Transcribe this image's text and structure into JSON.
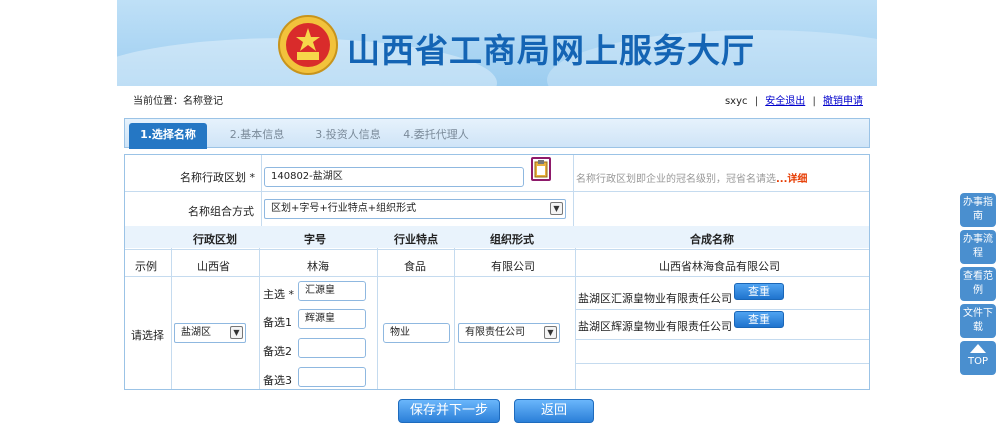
{
  "banner": {
    "title": "山西省工商局网上服务大厅"
  },
  "topbar": {
    "breadcrumb": "当前位置：名称登记",
    "username": "sxyc",
    "logout": "安全退出",
    "withdraw": "撤销申请"
  },
  "tabs": [
    {
      "label": "1.选择名称"
    },
    {
      "label": "2.基本信息"
    },
    {
      "label": "3.投资人信息"
    },
    {
      "label": "4.委托代理人"
    }
  ],
  "form": {
    "region_label": "名称行政区划 *",
    "region_value": "140802-盐湖区",
    "hint": "名称行政区划即企业的冠名级别，冠省名请选",
    "hint_link": "...详细",
    "combo_label": "名称组合方式",
    "combo_value": "区划+字号+行业特点+组织形式"
  },
  "table": {
    "headers": [
      "行政区划",
      "字号",
      "行业特点",
      "组织形式",
      "合成名称"
    ],
    "example": {
      "label": "示例",
      "region": "山西省",
      "name": "林海",
      "industry": "食品",
      "org": "有限公司",
      "full": "山西省林海食品有限公司"
    },
    "choose_label": "请选择",
    "region_select": "盐湖区",
    "main_label": "主选 *",
    "main_value": "汇源皇",
    "alt1_label": "备选1",
    "alt1_value": "辉源皇",
    "alt2_label": "备选2",
    "alt2_value": "",
    "alt3_label": "备选3",
    "alt3_value": "",
    "industry_value": "物业",
    "org_select": "有限责任公司",
    "results": [
      "盐湖区汇源皇物业有限责任公司",
      "盐湖区辉源皇物业有限责任公司"
    ],
    "check_label": "查重"
  },
  "buttons": {
    "save_next": "保存并下一步",
    "back": "返回"
  },
  "sidebar": [
    {
      "label": "办事指南"
    },
    {
      "label": "办事流程"
    },
    {
      "label": "查看范例"
    },
    {
      "label": "文件下载"
    },
    {
      "label": "TOP"
    }
  ],
  "colors": {
    "accent": "#2577c4",
    "banner_title": "#1464b4",
    "border": "#9bc3e6"
  }
}
